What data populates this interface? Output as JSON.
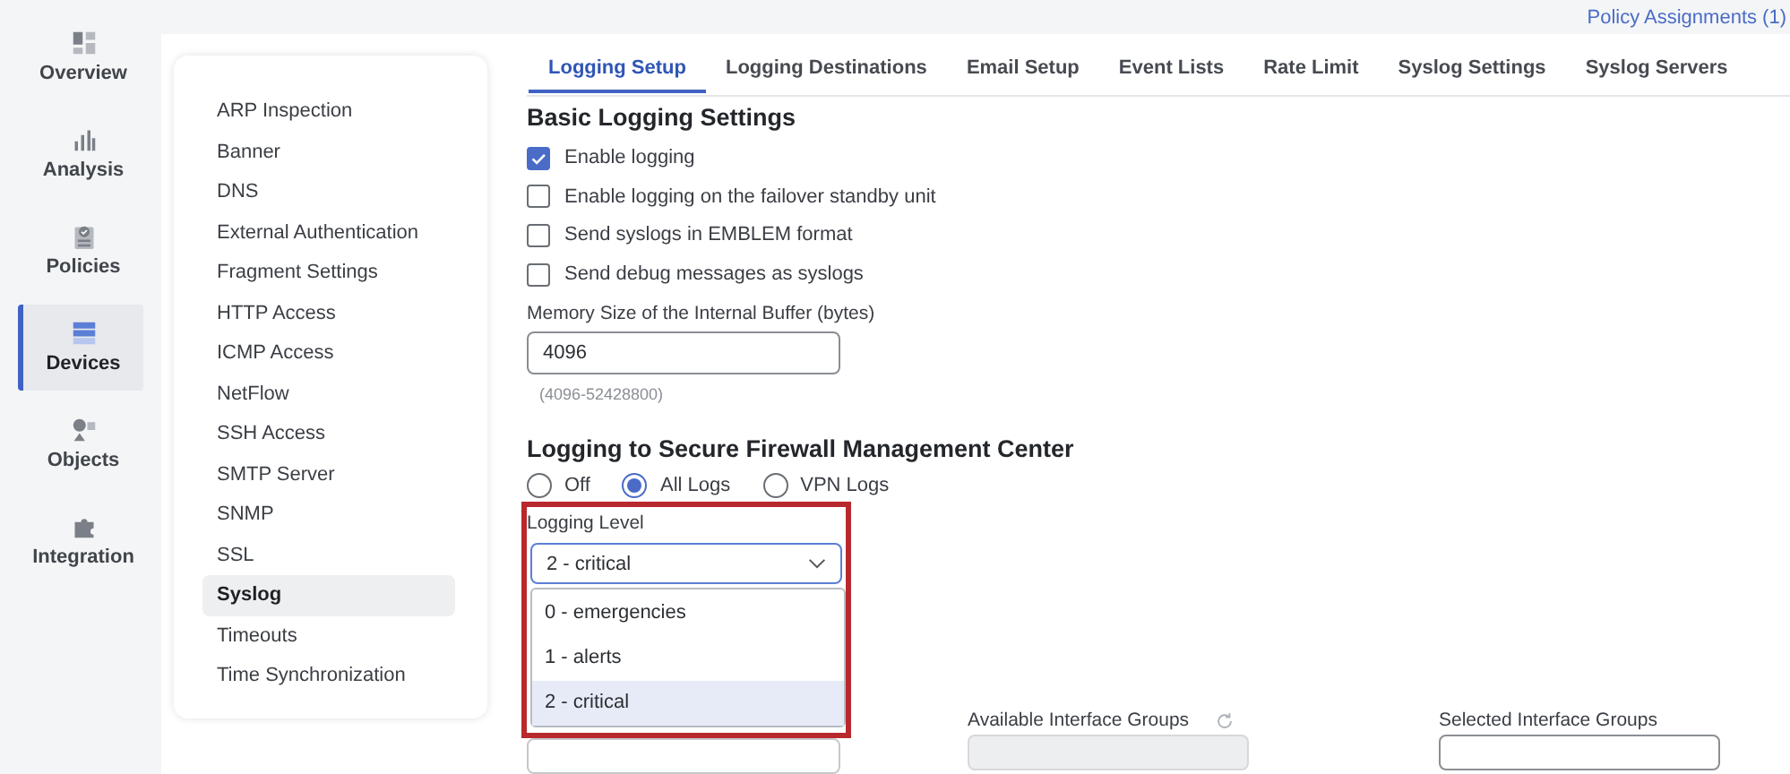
{
  "nav": [
    {
      "label": "Overview",
      "selected": false
    },
    {
      "label": "Analysis",
      "selected": false
    },
    {
      "label": "Policies",
      "selected": false
    },
    {
      "label": "Devices",
      "selected": true
    },
    {
      "label": "Objects",
      "selected": false
    },
    {
      "label": "Integration",
      "selected": false
    }
  ],
  "top_link": "Policy Assignments (1)",
  "settings_menu": [
    {
      "label": "ARP Inspection",
      "selected": false
    },
    {
      "label": "Banner",
      "selected": false
    },
    {
      "label": "DNS",
      "selected": false
    },
    {
      "label": "External Authentication",
      "selected": false
    },
    {
      "label": "Fragment Settings",
      "selected": false
    },
    {
      "label": "HTTP Access",
      "selected": false
    },
    {
      "label": "ICMP Access",
      "selected": false
    },
    {
      "label": "NetFlow",
      "selected": false
    },
    {
      "label": "SSH Access",
      "selected": false
    },
    {
      "label": "SMTP Server",
      "selected": false
    },
    {
      "label": "SNMP",
      "selected": false
    },
    {
      "label": "SSL",
      "selected": false
    },
    {
      "label": "Syslog",
      "selected": true
    },
    {
      "label": "Timeouts",
      "selected": false
    },
    {
      "label": "Time Synchronization",
      "selected": false
    }
  ],
  "tabs": [
    {
      "label": "Logging Setup",
      "selected": true
    },
    {
      "label": "Logging Destinations",
      "selected": false
    },
    {
      "label": "Email Setup",
      "selected": false
    },
    {
      "label": "Event Lists",
      "selected": false
    },
    {
      "label": "Rate Limit",
      "selected": false
    },
    {
      "label": "Syslog Settings",
      "selected": false
    },
    {
      "label": "Syslog Servers",
      "selected": false
    }
  ],
  "basic": {
    "title": "Basic Logging Settings",
    "checkboxes": [
      {
        "label": "Enable logging",
        "checked": true
      },
      {
        "label": "Enable logging on the failover standby unit",
        "checked": false
      },
      {
        "label": "Send syslogs in EMBLEM format",
        "checked": false
      },
      {
        "label": "Send debug messages as syslogs",
        "checked": false
      }
    ],
    "buffer_label": "Memory Size of the Internal Buffer (bytes)",
    "buffer_value": "4096",
    "buffer_hint": "(4096-52428800)"
  },
  "fmc": {
    "title": "Logging to Secure Firewall Management Center",
    "radios": [
      {
        "label": "Off",
        "selected": false
      },
      {
        "label": "All Logs",
        "selected": true
      },
      {
        "label": "VPN Logs",
        "selected": false
      }
    ],
    "level_label": "Logging Level",
    "level_value": "2 - critical",
    "level_options": [
      {
        "label": "0 - emergencies",
        "selected": false
      },
      {
        "label": "1 - alerts",
        "selected": false
      },
      {
        "label": "2 - critical",
        "selected": true
      }
    ]
  },
  "available_groups_label": "Available Interface Groups",
  "selected_groups_label": "Selected Interface Groups"
}
